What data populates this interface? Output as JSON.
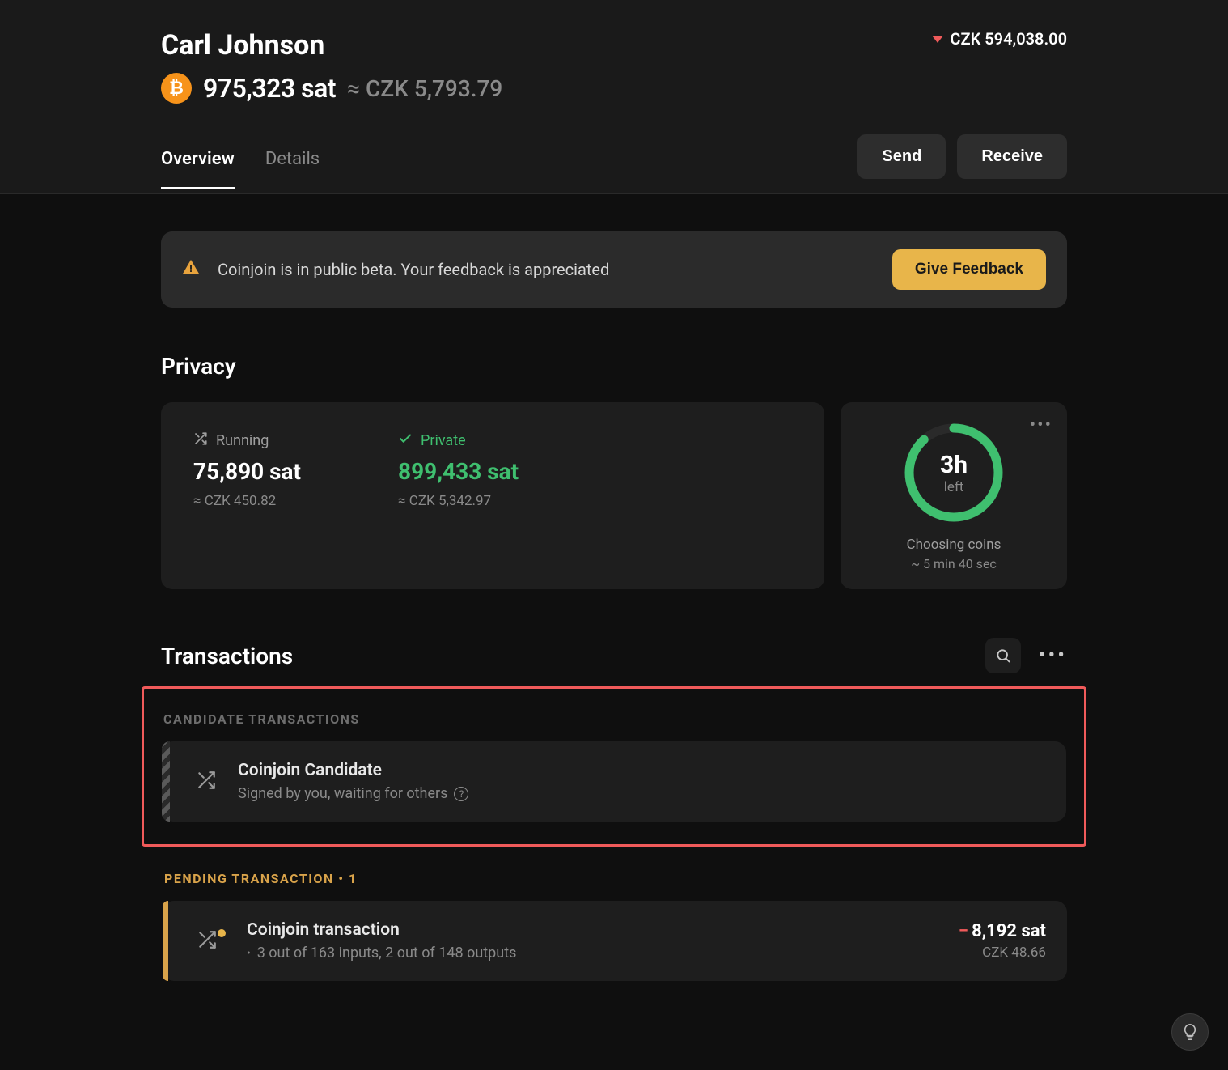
{
  "header": {
    "account_name": "Carl Johnson",
    "total_fiat": "CZK 594,038.00",
    "balance_amount": "975,323 sat",
    "balance_fiat_prefix": "≈ ",
    "balance_fiat": "CZK 5,793.79"
  },
  "tabs": {
    "overview": "Overview",
    "details": "Details"
  },
  "actions": {
    "send": "Send",
    "receive": "Receive"
  },
  "banner": {
    "text": "Coinjoin is in public beta. Your feedback is appreciated",
    "button": "Give Feedback"
  },
  "privacy": {
    "title": "Privacy",
    "running": {
      "label": "Running",
      "value": "75,890 sat",
      "fiat": "≈ CZK 450.82"
    },
    "private": {
      "label": "Private",
      "value": "899,433 sat",
      "fiat": "≈ CZK 5,342.97"
    },
    "timer": {
      "big": "3h",
      "sub": "left",
      "status": "Choosing coins",
      "eta": "~ 5 min 40 sec"
    }
  },
  "transactions": {
    "title": "Transactions",
    "candidate_heading": "CANDIDATE TRANSACTIONS",
    "candidate": {
      "title": "Coinjoin Candidate",
      "subtitle": "Signed by you, waiting for others"
    },
    "pending_heading": "PENDING TRANSACTION • 1",
    "pending": {
      "title": "Coinjoin transaction",
      "subtitle": "3 out of 163 inputs, 2 out of 148 outputs",
      "amount": "8,192 sat",
      "fiat": "CZK 48.66"
    }
  }
}
